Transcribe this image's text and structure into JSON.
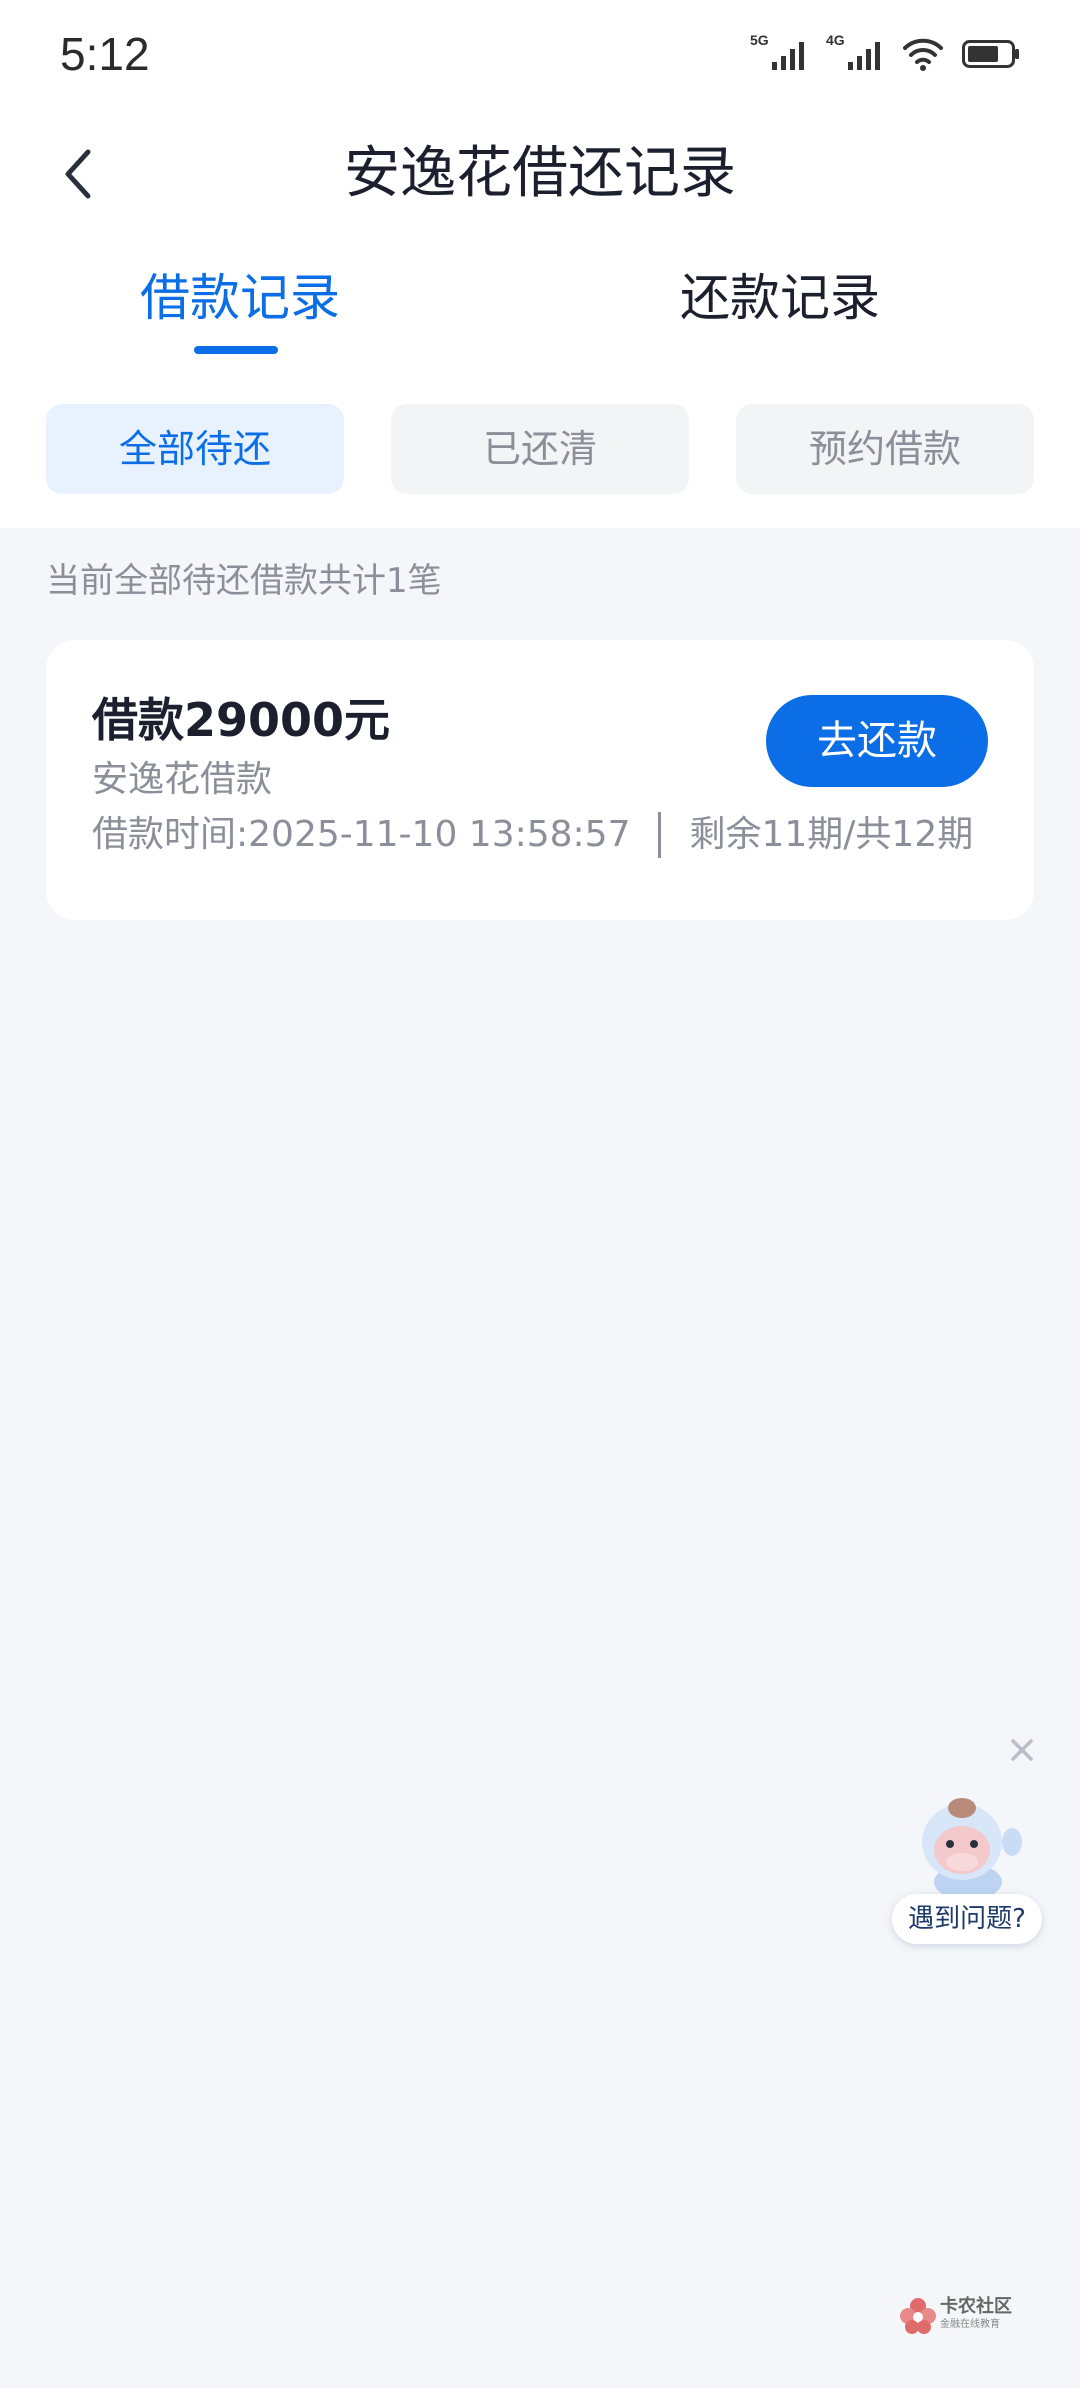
{
  "status_bar": {
    "time": "5:12",
    "signal1_tag": "5G",
    "signal2_tag": "4G"
  },
  "header": {
    "title": "安逸花借还记录"
  },
  "tabs": [
    {
      "label": "借款记录",
      "active": true
    },
    {
      "label": "还款记录",
      "active": false
    }
  ],
  "filters": [
    {
      "label": "全部待还",
      "active": true
    },
    {
      "label": "已还清",
      "active": false
    },
    {
      "label": "预约借款",
      "active": false
    }
  ],
  "summary": "当前全部待还借款共计1笔",
  "loans": [
    {
      "amount": "借款29000元",
      "product": "安逸花借款",
      "time": "借款时间:2025-11-10 13:58:57",
      "periods": "剩余11期/共12期",
      "action_label": "去还款"
    }
  ],
  "help": {
    "label": "遇到问题?"
  },
  "watermark": {
    "title": "卡农社区",
    "subtitle": "金融在线教育"
  },
  "colors": {
    "accent": "#0b6ee6",
    "background": "#f4f6f9",
    "muted_text": "#8b8f99"
  },
  "icons": [
    "back-arrow-icon",
    "signal-icon",
    "wifi-icon",
    "battery-icon",
    "close-icon"
  ]
}
